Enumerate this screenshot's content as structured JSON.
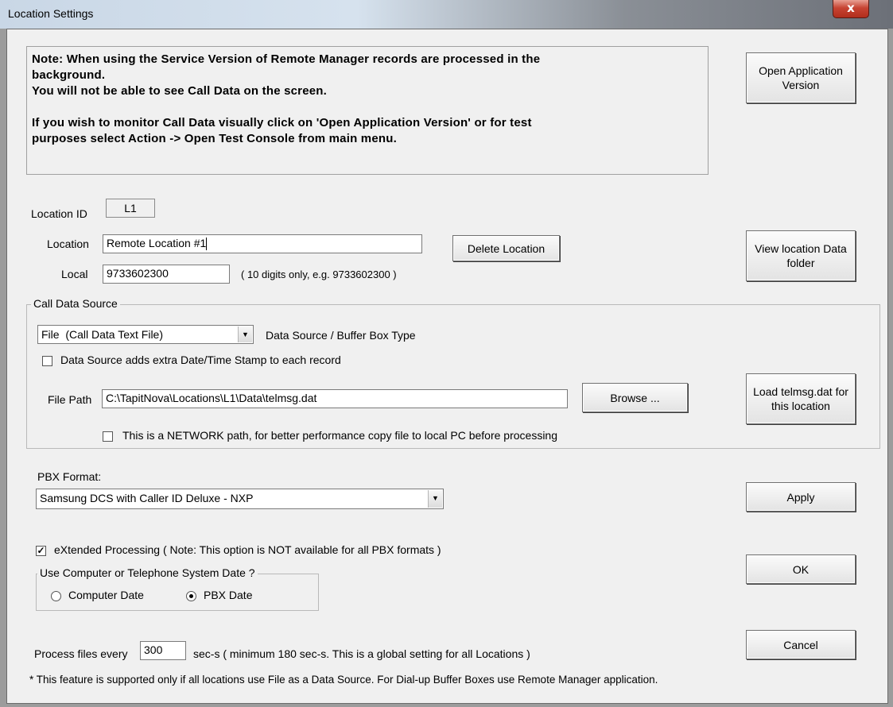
{
  "window": {
    "title": "Location Settings",
    "close_label": "x"
  },
  "note": {
    "lines": [
      "Note: When using the Service Version of Remote Manager records are processed in the",
      "background.",
      "You will not be able to see Call Data on the screen.",
      "",
      "If you wish to monitor Call Data visually click on 'Open Application Version' or for test",
      "purposes select Action -> Open Test Console from main menu."
    ]
  },
  "buttons": {
    "open_app": "Open Application Version",
    "delete_location": "Delete Location",
    "view_folder": "View location Data folder",
    "load_telmsg": "Load telmsg.dat for this location",
    "browse": "Browse ...",
    "apply": "Apply",
    "ok": "OK",
    "cancel": "Cancel"
  },
  "location": {
    "id_label": "Location ID",
    "id_value": "L1",
    "name_label": "Location",
    "name_value": "Remote Location #1",
    "local_label": "Local",
    "local_value": "9733602300",
    "local_hint": "( 10 digits only, e.g. 9733602300 )"
  },
  "call_data_source": {
    "group_label": "Call Data Source",
    "source_value": "File  (Call Data Text File)",
    "source_type_label": "Data Source / Buffer Box Type",
    "timestamp_label": "Data Source adds extra Date/Time Stamp to each record",
    "timestamp_checked": false,
    "file_path_label": "File Path",
    "file_path_value": "C:\\TapitNova\\Locations\\L1\\Data\\telmsg.dat",
    "network_label": "This is a NETWORK path, for better performance copy file to local PC before processing",
    "network_checked": false
  },
  "pbx": {
    "label": "PBX Format:",
    "value": "Samsung DCS with Caller ID Deluxe - NXP"
  },
  "extended": {
    "label": "eXtended Processing ( Note: This option is NOT available for all PBX formats )",
    "checked": true
  },
  "date_group": {
    "label": "Use Computer or Telephone System Date ?",
    "computer_label": "Computer Date",
    "pbx_label": "PBX Date",
    "selected": "PBX Date"
  },
  "process": {
    "label": "Process files every",
    "value": "300",
    "suffix": "sec-s  ( minimum 180 sec-s. This is a global setting for all Locations )",
    "footnote": "* This feature is supported only if all locations use File as a Data Source.  For Dial-up Buffer Boxes use Remote Manager application."
  },
  "icons": {
    "combo_arrow": "dropdown-arrow-icon",
    "check": "checkmark-icon"
  }
}
